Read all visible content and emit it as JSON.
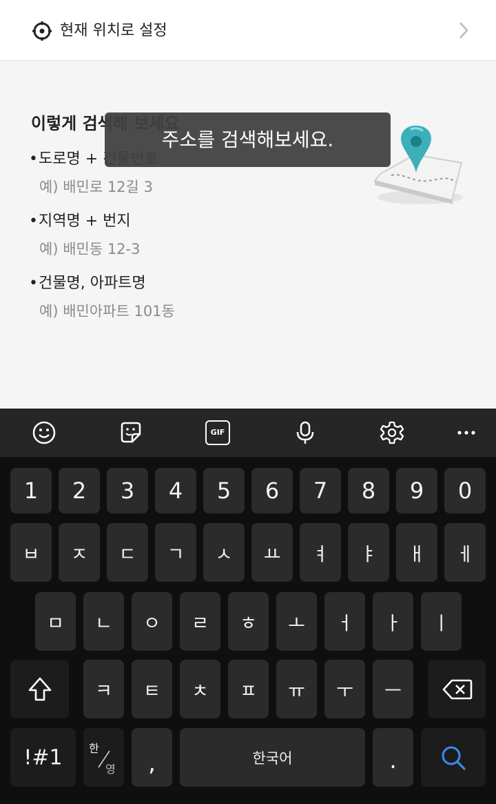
{
  "location": {
    "label": "현재 위치로 설정"
  },
  "guide": {
    "title": "이렇게 검색해 보세요",
    "items": [
      {
        "bullet": "•",
        "label": "도로명 + 건물번호",
        "example": "예) 배민로 12길 3"
      },
      {
        "bullet": "•",
        "label": "지역명 + 번지",
        "example": "예) 배민동 12-3"
      },
      {
        "bullet": "•",
        "label": "건물명, 아파트명",
        "example": "예) 배민아파트 101동"
      }
    ]
  },
  "toast": {
    "message": "주소를 검색해보세요."
  },
  "keyboard": {
    "toolbar": {
      "gif": "GIF"
    },
    "row_numbers": [
      "1",
      "2",
      "3",
      "4",
      "5",
      "6",
      "7",
      "8",
      "9",
      "0"
    ],
    "row1": [
      "ㅂ",
      "ㅈ",
      "ㄷ",
      "ㄱ",
      "ㅅ",
      "ㅛ",
      "ㅕ",
      "ㅑ",
      "ㅐ",
      "ㅔ"
    ],
    "row2": [
      "ㅁ",
      "ㄴ",
      "ㅇ",
      "ㄹ",
      "ㅎ",
      "ㅗ",
      "ㅓ",
      "ㅏ",
      "ㅣ"
    ],
    "row3": [
      "ㅋ",
      "ㅌ",
      "ㅊ",
      "ㅍ",
      "ㅠ",
      "ㅜ",
      "ㅡ"
    ],
    "symbols": "!#1",
    "lang_top": "한",
    "lang_bottom": "영",
    "comma": ",",
    "space": "한국어",
    "period": "."
  },
  "colors": {
    "search_icon": "#3d8bf2",
    "keyboard_bg": "#0f0f0f",
    "key_bg": "#2b2b2b"
  }
}
